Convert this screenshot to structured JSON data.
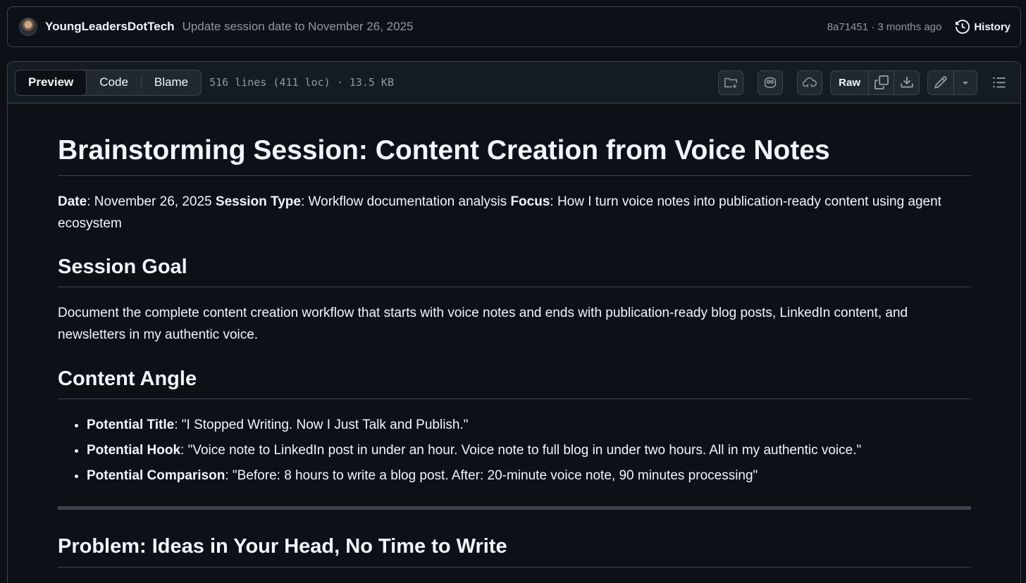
{
  "commit": {
    "author": "YoungLeadersDotTech",
    "message": "Update session date to November 26, 2025",
    "meta": "8a71451 · 3 months ago",
    "history_label": "History"
  },
  "file_header": {
    "tabs": [
      "Preview",
      "Code",
      "Blame"
    ],
    "info": "516 lines (411 loc) · 13.5 KB",
    "raw_label": "Raw"
  },
  "doc": {
    "title": "Brainstorming Session: Content Creation from Voice Notes",
    "meta": {
      "date_label": "Date",
      "date_value": ": November 26, 2025 ",
      "type_label": "Session Type",
      "type_value": ": Workflow documentation analysis ",
      "focus_label": "Focus",
      "focus_value": ": How I turn voice notes into publication-ready content using agent ecosystem"
    },
    "goal_heading": "Session Goal",
    "goal_text": "Document the complete content creation workflow that starts with voice notes and ends with publication-ready blog posts, LinkedIn content, and newsletters in my authentic voice.",
    "angle_heading": "Content Angle",
    "angle_items": [
      {
        "label": "Potential Title",
        "text": ": \"I Stopped Writing. Now I Just Talk and Publish.\""
      },
      {
        "label": "Potential Hook",
        "text": ": \"Voice note to LinkedIn post in under an hour. Voice note to full blog in under two hours. All in my authentic voice.\""
      },
      {
        "label": "Potential Comparison",
        "text": ": \"Before: 8 hours to write a blog post. After: 20-minute voice note, 90 minutes processing\""
      }
    ],
    "problem_heading": "Problem: Ideas in Your Head, No Time to Write"
  },
  "icons": [
    "history-icon",
    "add-file-icon",
    "copilot-icon",
    "codespaces-icon",
    "copy-icon",
    "download-icon",
    "pencil-icon",
    "triangle-down-icon",
    "outline-list-icon"
  ]
}
